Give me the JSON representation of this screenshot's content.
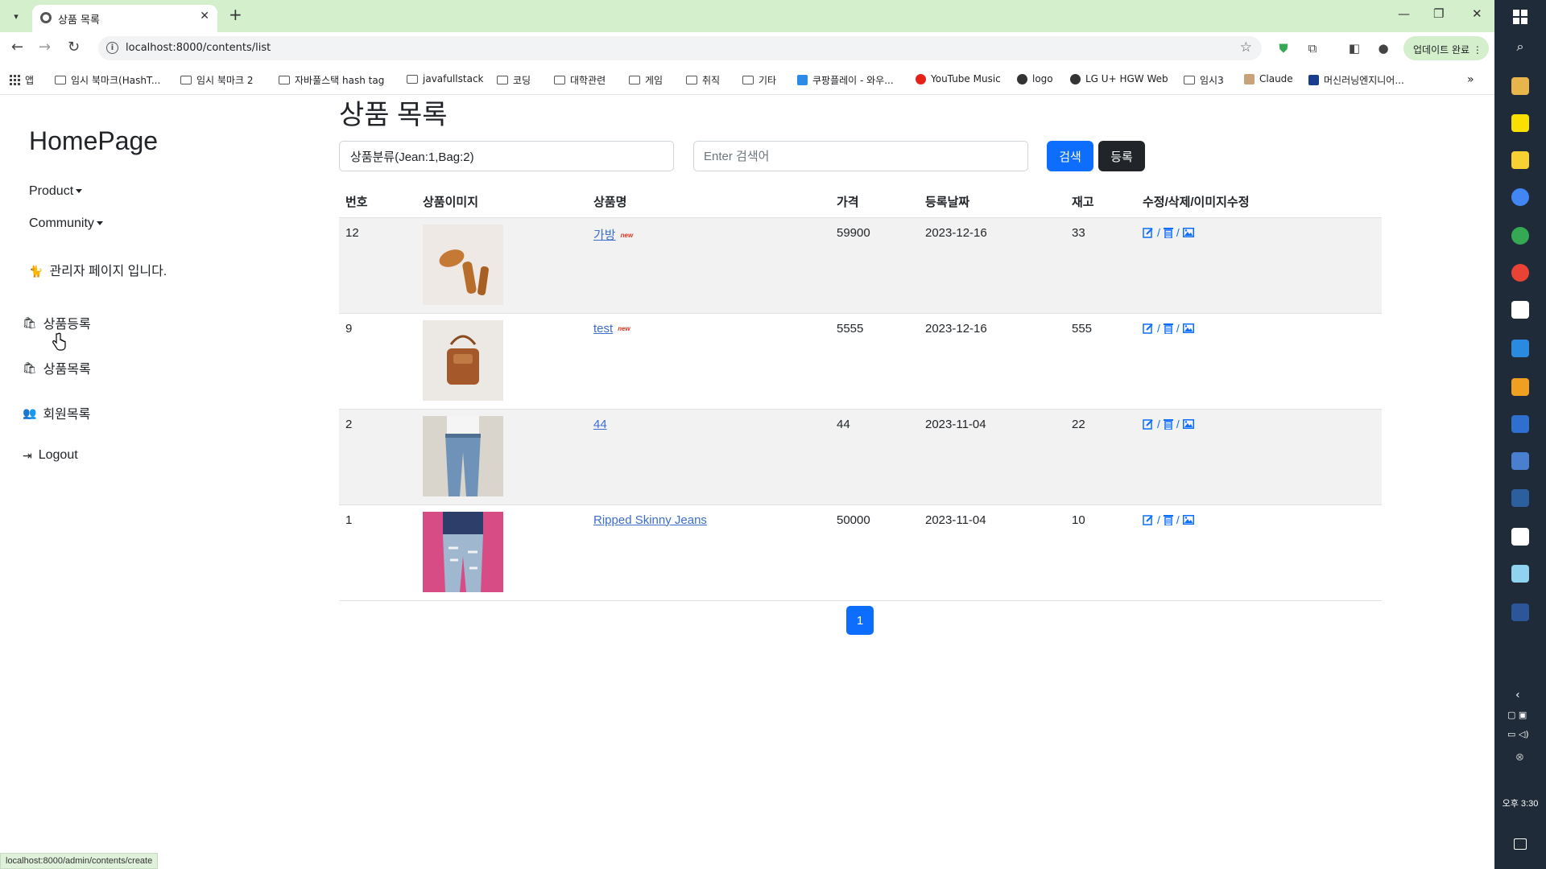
{
  "browser": {
    "tab_title": "상품 목록",
    "url": "localhost:8000/contents/list",
    "update_button": "업데이트 완료",
    "status_url": "localhost:8000/admin/contents/create",
    "bookmarks": [
      "앱",
      "임시 북마크(HashT...",
      "임시 북마크 2",
      "자바풀스택 hash tag",
      "javafullstack",
      "코딩",
      "대학관련",
      "게임",
      "취직",
      "기타",
      "쿠팡플레이 - 와우...",
      "YouTube Music",
      "logo",
      "LG U+ HGW Web",
      "임시3",
      "Claude",
      "머신러닝엔지니어..."
    ]
  },
  "sidebar": {
    "brand": "HomePage",
    "product_menu": "Product",
    "community_menu": "Community",
    "admin_note": "관리자 페이지 입니다.",
    "links": {
      "product_create": "상품등록",
      "product_list": "상품목록",
      "member_list": "회원목록",
      "logout": "Logout"
    }
  },
  "main": {
    "title": "상품 목록",
    "category_select": "상품분류(Jean:1,Bag:2)",
    "search_placeholder": "Enter 검색어",
    "search_button": "검색",
    "register_button": "등록",
    "columns": [
      "번호",
      "상품이미지",
      "상품명",
      "가격",
      "등록날짜",
      "재고",
      "수정/삭제/이미지수정"
    ],
    "rows": [
      {
        "id": "12",
        "name": "가방",
        "is_new": true,
        "price": "59900",
        "date": "2023-12-16",
        "stock": "33"
      },
      {
        "id": "9",
        "name": "test",
        "is_new": true,
        "price": "5555",
        "date": "2023-12-16",
        "stock": "555"
      },
      {
        "id": "2",
        "name": "44",
        "is_new": false,
        "price": "44",
        "date": "2023-11-04",
        "stock": "22"
      },
      {
        "id": "1",
        "name": "Ripped Skinny Jeans",
        "is_new": false,
        "price": "50000",
        "date": "2023-11-04",
        "stock": "10"
      }
    ],
    "new_badge": "new",
    "action_sep": "/",
    "page": "1"
  },
  "taskbar": {
    "clock": "오후 3:30"
  },
  "colors": {
    "primary": "#0d6efd",
    "dark": "#212529",
    "tabbar": "#d3efcc",
    "taskbar": "#1f2b38"
  }
}
